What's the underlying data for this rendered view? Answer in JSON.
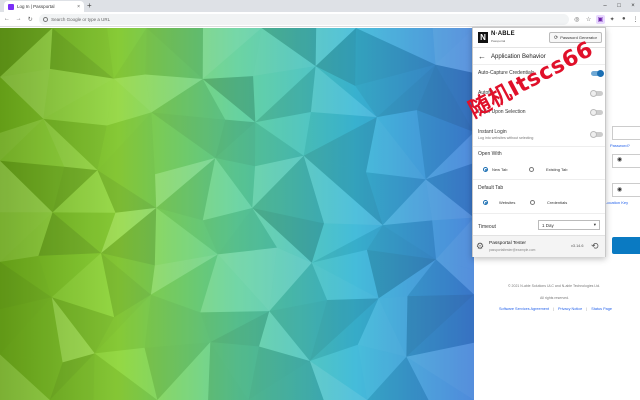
{
  "browser": {
    "tab_title": "Log In | Passportal",
    "tab_close": "×",
    "new_tab": "+",
    "omnibox_placeholder": "Search Google or type a URL",
    "win_controls": [
      "–",
      "□",
      "×"
    ]
  },
  "page": {
    "forgot_password": "Password?",
    "location_key": "Location Key",
    "footer_copyright": "© 2021 N-able Solutions ULC and N-able Technologies Ltd.",
    "footer_rights": "All rights reserved.",
    "footer_links": [
      "Software Services Agreement",
      "Privacy Notice",
      "Status Page"
    ],
    "accent_color": "#0a7ac2"
  },
  "extension": {
    "brand": "N·ABLE",
    "brand_sub": "Passportal",
    "generator_button": "Password Generator",
    "section_title": "Application Behavior",
    "settings": [
      {
        "label": "Auto-Capture Credentials",
        "on": true
      },
      {
        "label": "Autofill",
        "on": false
      },
      {
        "label": "Login Upon Selection",
        "on": false
      },
      {
        "label": "Instant Login",
        "sub": "Log into websites without selecting",
        "on": false
      }
    ],
    "open_with": {
      "label": "Open With",
      "options": [
        "New Tab",
        "Existing Tab"
      ],
      "selected": 0
    },
    "default_tab": {
      "label": "Default Tab",
      "options": [
        "Websites",
        "Credentials"
      ],
      "selected": 0
    },
    "timeout": {
      "label": "Timeout",
      "value": "1 Day"
    },
    "user": {
      "name": "Passportal Tester",
      "email": "passportaltester@example.com"
    },
    "version": "v3.14.6"
  },
  "watermark": "随机Itscs66"
}
